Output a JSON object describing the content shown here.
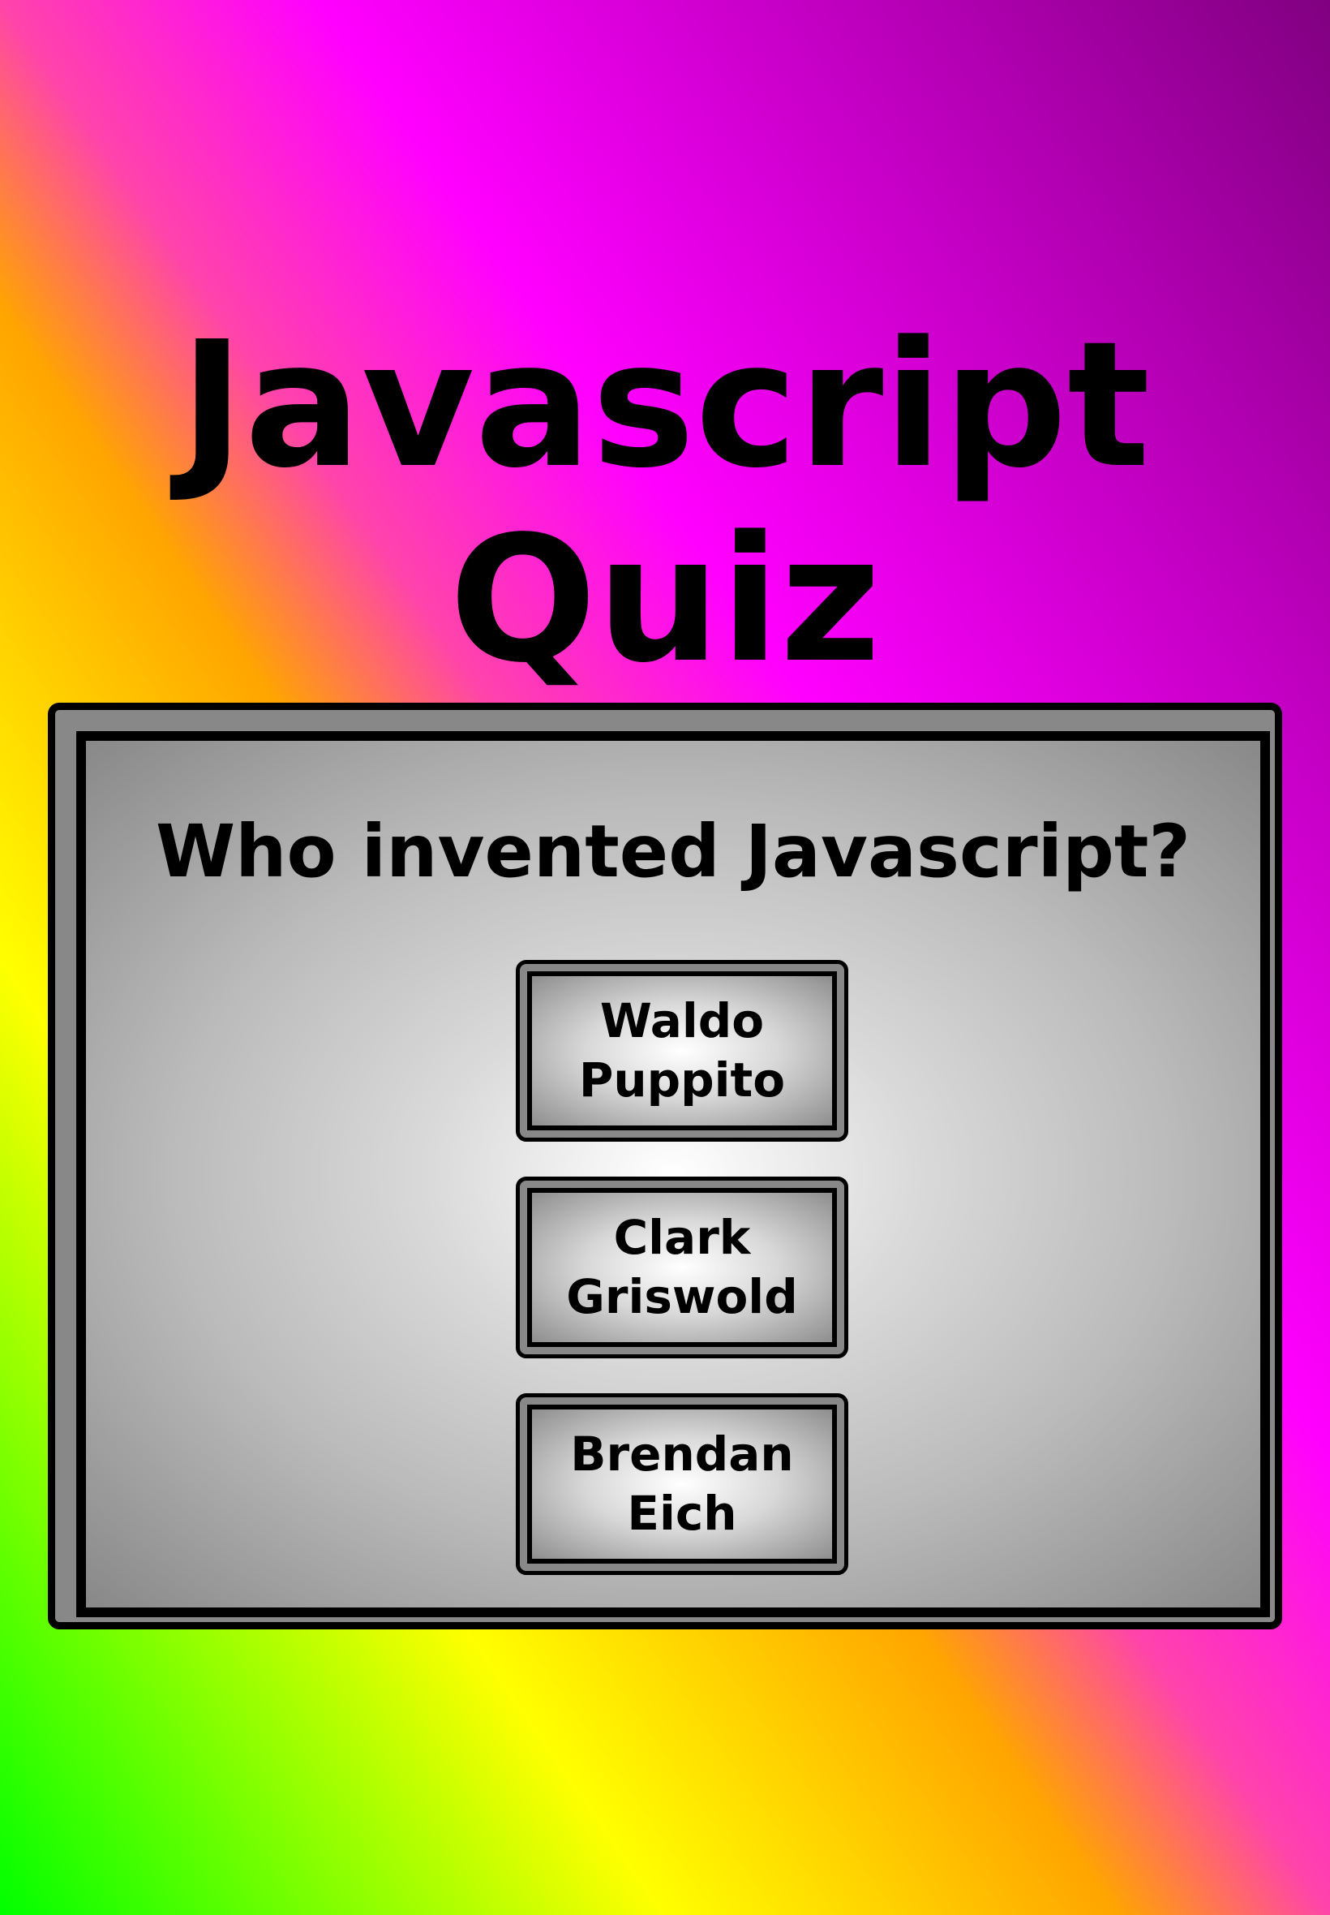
{
  "title": {
    "line1": "Javascript",
    "line2": "Quiz"
  },
  "question": "Who invented Javascript?",
  "answers": [
    {
      "label": "Waldo\nPuppito"
    },
    {
      "label": "Clark\nGriswold"
    },
    {
      "label": "Brendan\nEich"
    }
  ],
  "colors": {
    "background_gradient": [
      "#00ff00",
      "#ffff00",
      "#ffa500",
      "#ff00ff",
      "#800080"
    ],
    "card_frame": "#888888",
    "card_center": "#ffffff",
    "text": "#000000"
  }
}
